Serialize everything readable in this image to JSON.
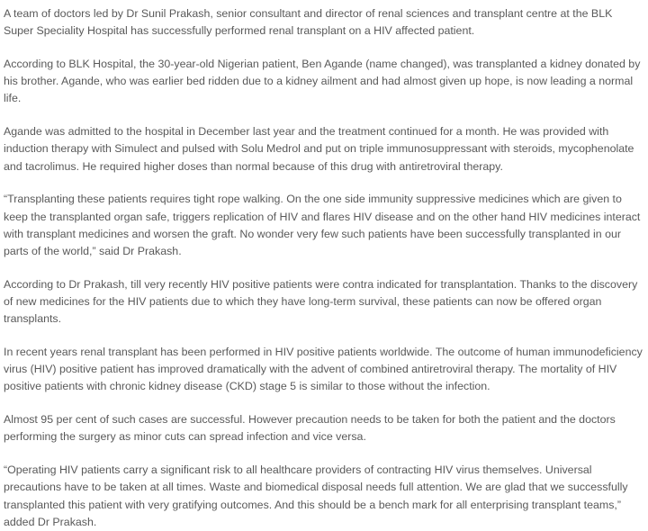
{
  "article": {
    "paragraphs": [
      "A team of doctors led by Dr Sunil Prakash, senior consultant and director of renal sciences and transplant centre at the BLK Super Speciality Hospital has successfully performed renal transplant on a HIV affected patient.",
      "According to BLK Hospital, the 30-year-old Nigerian patient, Ben Agande (name changed), was transplanted a kidney donated by his brother. Agande, who was earlier bed ridden due to a kidney ailment and had almost given up hope, is now leading a normal life.",
      "Agande was admitted to the hospital in December last year and the treatment continued for a month. He was provided with induction therapy with Simulect and pulsed with Solu Medrol and put on triple immunosuppressant with steroids, mycophenolate and tacrolimus. He required higher doses than normal because of this drug with antiretroviral therapy.",
      "“Transplanting these patients requires tight rope walking. On the one side immunity suppressive medicines which are given to keep the transplanted organ safe, triggers replication of HIV and flares HIV disease and on the other hand HIV medicines interact with transplant medicines and worsen the graft. No wonder very few such patients have been successfully transplanted in our parts of the world,” said Dr Prakash.",
      "According to Dr Prakash, till very recently HIV positive patients were contra indicated for transplantation. Thanks to the discovery of new medicines for the HIV patients due to which they have long-term survival, these patients can now be offered organ transplants.",
      "In recent years renal transplant has been performed in HIV positive patients worldwide. The outcome of human immunodeficiency virus (HIV) positive patient has improved dramatically with the advent of combined antiretroviral therapy. The mortality of HIV positive patients with chronic kidney disease (CKD) stage 5 is similar to those without the infection.",
      "Almost 95 per cent of such cases are successful. However precaution needs to be taken for both the patient and the doctors performing the surgery as minor cuts can spread infection and vice versa.",
      "“Operating HIV patients carry a significant risk to all healthcare providers of contracting HIV virus themselves. Universal precautions have to be taken at all times. Waste and biomedical disposal needs full attention. We are glad that we successfully transplanted this patient with very gratifying outcomes. And this should be a bench mark for all enterprising transplant teams,” added Dr Prakash."
    ]
  },
  "colors": {
    "text": "#595959",
    "background": "#ffffff"
  }
}
